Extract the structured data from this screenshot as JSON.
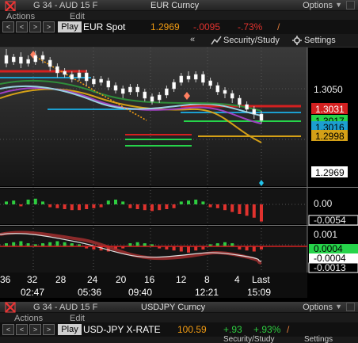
{
  "window1": {
    "title": "G 34 - AUD 15 F",
    "security_title": "EUR Curncy",
    "options_label": "Options",
    "menu": [
      "Actions",
      "Edit"
    ],
    "play_label": "Play",
    "security_name": "EUR Spot",
    "last_price": "1.2969",
    "net_change": "-.0095",
    "pct_change": "-.73%",
    "collapse_glyph": "«",
    "security_study_label": "Security/Study",
    "settings_label": "Settings"
  },
  "window2": {
    "title": "G 34 - AUD 15 F",
    "security_title": "USDJPY Curncy",
    "options_label": "Options",
    "menu": [
      "Actions",
      "Edit"
    ],
    "play_label": "Play",
    "security_name": "USD-JPY X-RATE",
    "last_price": "100.59",
    "net_change": "+.93",
    "pct_change": "+.93%",
    "security_study_label": "Security/Study",
    "settings_label": "Settings"
  },
  "colors": {
    "orange": "#f39c12",
    "up": "#2ecc40",
    "down": "#e0322e",
    "cyan": "#22c3ea"
  },
  "chart_data": {
    "type": "candlestick",
    "price_axis_label": "1.3050",
    "price_tags": [
      {
        "value": "1.3031",
        "bg": "#d42020",
        "fg": "#ffffff"
      },
      {
        "value": "1.3017",
        "bg": "#26d44a",
        "fg": "#000000"
      },
      {
        "value": "1.3016",
        "bg": "#1c9fd0",
        "fg": "#000000"
      },
      {
        "value": "1.2998",
        "bg": "#d4a017",
        "fg": "#000000"
      },
      {
        "value": "1.2969",
        "bg": "#ffffff",
        "fg": "#000000"
      }
    ],
    "histogram_labels": [
      "0.00",
      "-0.0054"
    ],
    "lower_labels": [
      "0.001",
      "0.0004",
      "-0.0004",
      "-0.0013"
    ],
    "x_ticks": [
      "36",
      "32",
      "28",
      "24",
      "20",
      "16",
      "12",
      "8",
      "4",
      "Last"
    ],
    "time_labels": [
      "02:47",
      "05:36",
      "09:40",
      "12:21",
      "15:09"
    ],
    "candles": [
      {
        "o": 80,
        "c": 70,
        "h": 62,
        "l": 85
      },
      {
        "o": 72,
        "c": 78,
        "h": 68,
        "l": 82
      },
      {
        "o": 80,
        "c": 72,
        "h": 66,
        "l": 86
      },
      {
        "o": 75,
        "c": 80,
        "h": 70,
        "l": 84
      },
      {
        "o": 78,
        "c": 70,
        "h": 64,
        "l": 82
      },
      {
        "o": 70,
        "c": 75,
        "h": 65,
        "l": 80
      },
      {
        "o": 76,
        "c": 84,
        "h": 72,
        "l": 90
      },
      {
        "o": 84,
        "c": 92,
        "h": 80,
        "l": 98
      },
      {
        "o": 90,
        "c": 94,
        "h": 86,
        "l": 98
      },
      {
        "o": 94,
        "c": 100,
        "h": 90,
        "l": 104
      },
      {
        "o": 98,
        "c": 92,
        "h": 88,
        "l": 102
      },
      {
        "o": 92,
        "c": 102,
        "h": 88,
        "l": 108
      },
      {
        "o": 100,
        "c": 106,
        "h": 96,
        "l": 110
      },
      {
        "o": 104,
        "c": 100,
        "h": 96,
        "l": 108
      },
      {
        "o": 102,
        "c": 110,
        "h": 98,
        "l": 114
      },
      {
        "o": 108,
        "c": 114,
        "h": 104,
        "l": 118
      },
      {
        "o": 112,
        "c": 118,
        "h": 108,
        "l": 124
      },
      {
        "o": 116,
        "c": 110,
        "h": 106,
        "l": 120
      },
      {
        "o": 110,
        "c": 116,
        "h": 106,
        "l": 122
      },
      {
        "o": 116,
        "c": 124,
        "h": 112,
        "l": 128
      },
      {
        "o": 122,
        "c": 128,
        "h": 118,
        "l": 132
      },
      {
        "o": 126,
        "c": 120,
        "h": 116,
        "l": 130
      },
      {
        "o": 120,
        "c": 112,
        "h": 108,
        "l": 124
      },
      {
        "o": 112,
        "c": 104,
        "h": 100,
        "l": 116
      },
      {
        "o": 104,
        "c": 96,
        "h": 92,
        "l": 108
      },
      {
        "o": 96,
        "c": 100,
        "h": 90,
        "l": 104
      },
      {
        "o": 100,
        "c": 94,
        "h": 90,
        "l": 104
      },
      {
        "o": 94,
        "c": 104,
        "h": 90,
        "l": 108
      },
      {
        "o": 102,
        "c": 108,
        "h": 98,
        "l": 112
      },
      {
        "o": 108,
        "c": 116,
        "h": 104,
        "l": 120
      },
      {
        "o": 114,
        "c": 118,
        "h": 110,
        "l": 124
      },
      {
        "o": 118,
        "c": 124,
        "h": 114,
        "l": 130
      },
      {
        "o": 124,
        "c": 132,
        "h": 120,
        "l": 136
      },
      {
        "o": 132,
        "c": 138,
        "h": 128,
        "l": 142
      },
      {
        "o": 138,
        "c": 144,
        "h": 134,
        "l": 150
      },
      {
        "o": 144,
        "c": 152,
        "h": 140,
        "l": 156
      }
    ],
    "histogram_top": [
      3,
      4,
      -2,
      5,
      6,
      3,
      -3,
      -4,
      -5,
      -6,
      -6,
      -5,
      -4,
      -3,
      4,
      5,
      3,
      -4,
      -5,
      -6,
      -7,
      -6,
      -5,
      -4,
      3,
      4,
      5,
      3,
      -3,
      -4,
      -6,
      -8,
      -10,
      -12,
      -14,
      -18
    ],
    "histogram_bottom": [
      3,
      4,
      5,
      3,
      2,
      3,
      4,
      5,
      4,
      3,
      2,
      -2,
      -3,
      -4,
      -5,
      -3,
      -2,
      3,
      4,
      3,
      2,
      -2,
      -3,
      -4,
      -5,
      -6,
      -4,
      -3,
      2,
      3,
      4,
      3,
      -3,
      -4,
      -5,
      -3
    ]
  }
}
